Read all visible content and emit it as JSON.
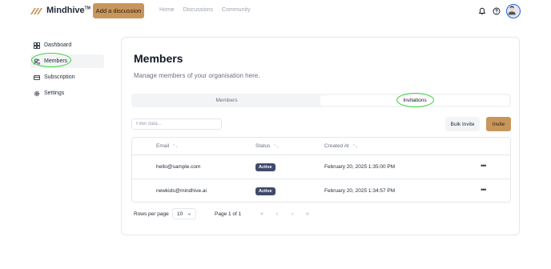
{
  "app": {
    "name": "Mindhive",
    "trademark": "TM"
  },
  "header": {
    "add_discussion_label": "Add a discussion",
    "nav": [
      {
        "label": "Home"
      },
      {
        "label": "Discussions"
      },
      {
        "label": "Community"
      }
    ],
    "icons": [
      "bell-icon",
      "help-icon",
      "avatar"
    ]
  },
  "sidebar": {
    "items": [
      {
        "label": "Dashboard",
        "icon": "dashboard-icon",
        "active": false
      },
      {
        "label": "Members",
        "icon": "users-icon",
        "active": true
      },
      {
        "label": "Subscription",
        "icon": "card-icon",
        "active": false
      },
      {
        "label": "Settings",
        "icon": "gear-icon",
        "active": false
      }
    ]
  },
  "main": {
    "title": "Members",
    "subtitle": "Manage members of your organisation here.",
    "tabs": [
      {
        "label": "Members",
        "selected": false
      },
      {
        "label": "Invitations",
        "selected": true
      }
    ],
    "filter_placeholder": "Filter data...",
    "bulk_invite_label": "Bulk Invite",
    "invite_label": "Invite",
    "table": {
      "columns": [
        "Email",
        "Status",
        "Created At"
      ],
      "rows": [
        {
          "email": "hello@sample.com",
          "status": "Active",
          "created_at": "February 20, 2025 1:35:00 PM",
          "action": "•••"
        },
        {
          "email": "newkids@mindhive.ai",
          "status": "Active",
          "created_at": "February 20, 2025 1:34:57 PM",
          "action": "•••"
        }
      ]
    },
    "pagination": {
      "rows_per_page_label": "Rows per page",
      "rows_per_page_value": "10",
      "page_info": "Page 1 of 1",
      "first": "«",
      "prev": "‹",
      "next": "›",
      "last": "»"
    }
  },
  "colors": {
    "accent": "#c8955b",
    "badge": "#3f4a6b",
    "annotation": "#3bd13b"
  }
}
